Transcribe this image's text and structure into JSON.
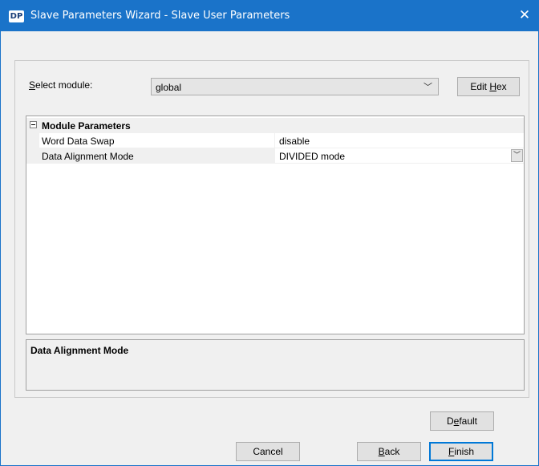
{
  "window": {
    "app_icon": "DP",
    "title": "Slave Parameters Wizard - Slave User Parameters"
  },
  "module_select": {
    "label_mnemonic": "S",
    "label_rest": "elect module:",
    "value": "global"
  },
  "edit_hex_button": {
    "pre": "Edit ",
    "mnemonic": "H",
    "post": "ex"
  },
  "grid": {
    "category": "Module Parameters",
    "rows": [
      {
        "name": "Word Data Swap",
        "value": "disable"
      },
      {
        "name": "Data Alignment Mode",
        "value": "DIVIDED mode"
      }
    ]
  },
  "description": {
    "title": "Data Alignment Mode"
  },
  "buttons": {
    "default": {
      "pre": "D",
      "mnemonic": "e",
      "post": "fault"
    },
    "cancel": "Cancel",
    "back": {
      "pre": "",
      "mnemonic": "B",
      "post": "ack"
    },
    "finish": {
      "pre": "",
      "mnemonic": "F",
      "post": "inish"
    }
  },
  "icons": {
    "close": "close-icon",
    "dropdown": "chevron-down-icon",
    "collapse": "minus-box-icon"
  },
  "colors": {
    "titlebar": "#1a73c9",
    "focus": "#0078d7"
  }
}
